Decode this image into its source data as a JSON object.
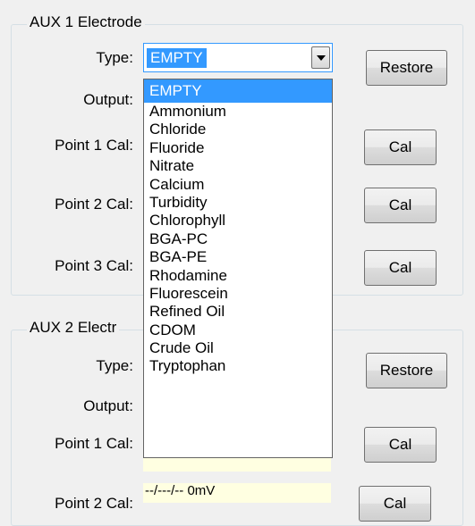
{
  "aux1": {
    "legend": "AUX 1 Electrode",
    "type_label": "Type:",
    "output_label": "Output:",
    "point1_label": "Point 1 Cal:",
    "point2_label": "Point 2 Cal:",
    "point3_label": "Point 3 Cal:",
    "type_value": "EMPTY",
    "restore_label": "Restore",
    "cal1_label": "Cal",
    "cal2_label": "Cal",
    "cal3_label": "Cal"
  },
  "dropdown": {
    "options": [
      "EMPTY",
      "Ammonium",
      "Chloride",
      "Fluoride",
      "Nitrate",
      "Calcium",
      "Turbidity",
      "Chlorophyll",
      "BGA-PC",
      "BGA-PE",
      "Rhodamine",
      "Fluorescein",
      "Refined Oil",
      "CDOM",
      "Crude Oil",
      "Tryptophan"
    ],
    "selected": "EMPTY"
  },
  "aux2": {
    "legend": "AUX 2 Electr",
    "type_label": "Type:",
    "output_label": "Output:",
    "point1_label": "Point 1 Cal:",
    "point2_label": "Point 2 Cal:",
    "restore_label": "Restore",
    "cal1_label": "Cal",
    "cal2_label": "Cal",
    "point2_value": "--/---/--  0mV"
  },
  "colors": {
    "selection": "#3399ff",
    "field_background": "#ffffe1",
    "window_background": "#f0f0f0"
  }
}
